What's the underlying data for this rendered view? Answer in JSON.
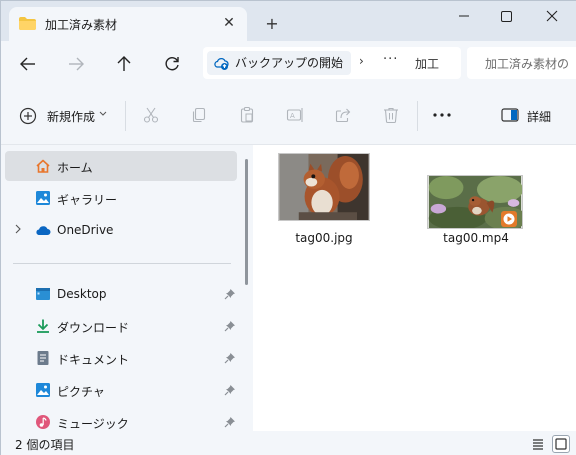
{
  "window": {
    "tab_title": "加工済み素材",
    "close_tab_glyph": "✕",
    "new_tab_glyph": "+"
  },
  "address_bar": {
    "root_label": "バックアップの開始",
    "separator": "›",
    "overflow": "···",
    "current_segment": "加工"
  },
  "search": {
    "placeholder": "加工済み素材の"
  },
  "toolbar": {
    "new_label": "新規作成",
    "details_label": "詳細"
  },
  "sidebar": {
    "items": [
      {
        "label": "ホーム",
        "icon": "home-icon",
        "selected": true
      },
      {
        "label": "ギャラリー",
        "icon": "gallery-icon",
        "selected": false
      },
      {
        "label": "OneDrive",
        "icon": "cloud-icon",
        "selected": false
      },
      {
        "label": "Desktop",
        "icon": "desktop-icon",
        "pinned": true
      },
      {
        "label": "ダウンロード",
        "icon": "download-icon",
        "pinned": true
      },
      {
        "label": "ドキュメント",
        "icon": "document-icon",
        "pinned": true
      },
      {
        "label": "ピクチャ",
        "icon": "pictures-icon",
        "pinned": true
      },
      {
        "label": "ミュージック",
        "icon": "music-icon",
        "pinned": true
      }
    ]
  },
  "files": [
    {
      "name": "tag00.jpg",
      "type": "image"
    },
    {
      "name": "tag00.mp4",
      "type": "video"
    }
  ],
  "status": {
    "item_count": "2 個の項目"
  },
  "colors": {
    "accent": "#0067c0",
    "folder": "#f4c542",
    "selection": "#dcdfe3"
  }
}
